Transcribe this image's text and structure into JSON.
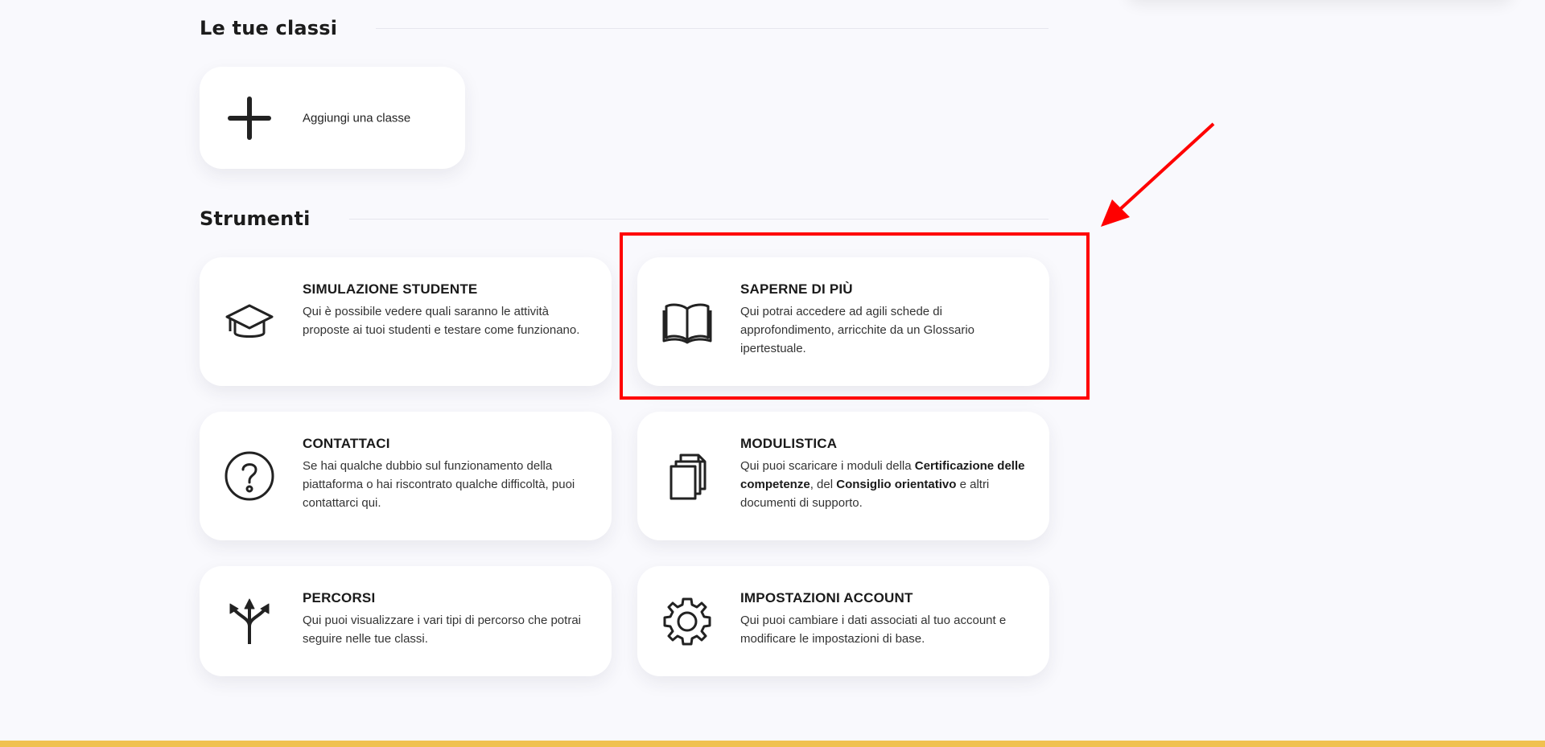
{
  "sections": {
    "classes_title": "Le tue classi",
    "tools_title": "Strumenti"
  },
  "add_class": {
    "label": "Aggiungi una classe"
  },
  "tools": [
    {
      "title": "SIMULAZIONE STUDENTE",
      "desc": "Qui è possibile vedere quali saranno le attività proposte ai tuoi studenti e testare come funzionano."
    },
    {
      "title": "SAPERNE DI PIÙ",
      "desc": "Qui potrai accedere ad agili schede di approfondimento, arricchite da un Glossario ipertestuale."
    },
    {
      "title": "CONTATTACI",
      "desc": "Se hai qualche dubbio sul funzionamento della piattaforma o hai riscontrato qualche difficoltà, puoi contattarci qui."
    },
    {
      "title": "MODULISTICA",
      "desc_parts": [
        "Qui puoi scaricare i moduli della ",
        "Certificazione delle competenze",
        ", del ",
        "Consiglio orientativo",
        " e altri documenti di supporto."
      ]
    },
    {
      "title": "PERCORSI",
      "desc": "Qui puoi visualizzare i vari tipi di percorso che potrai seguire nelle tue classi."
    },
    {
      "title": "IMPOSTAZIONI ACCOUNT",
      "desc": "Qui puoi cambiare i dati associati al tuo account e modificare le impostazioni di base."
    }
  ],
  "icons": {
    "add": "plus-icon",
    "tools": [
      "graduation-cap-icon",
      "open-book-icon",
      "question-circle-icon",
      "documents-icon",
      "split-arrows-icon",
      "gear-icon"
    ]
  },
  "colors": {
    "highlight": "#ff0000",
    "footer": "#f0c150",
    "background": "#f9f9fd"
  }
}
